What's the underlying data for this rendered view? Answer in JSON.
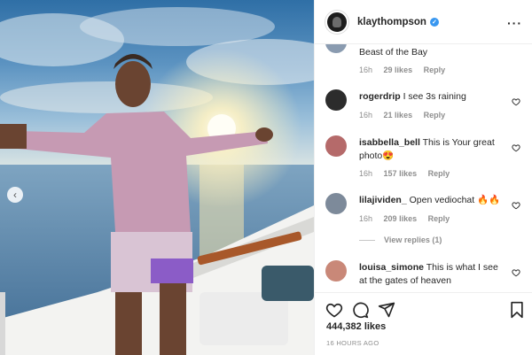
{
  "post": {
    "username": "klaythompson",
    "likes": "444,382 likes",
    "time_ago": "16 HOURS AGO"
  },
  "comments": [
    {
      "user": "",
      "text": "Beast of the Bay",
      "age": "16h",
      "likes": "29 likes",
      "reply": "Reply",
      "avatar_color": "#8a9bb0"
    },
    {
      "user": "rogerdrip",
      "text": "I see 3s raining",
      "age": "16h",
      "likes": "21 likes",
      "reply": "Reply",
      "avatar_color": "#2c2c2c"
    },
    {
      "user": "isabbella_bell",
      "text": "This is Your great photo😍",
      "age": "16h",
      "likes": "157 likes",
      "reply": "Reply",
      "avatar_color": "#b56a6a"
    },
    {
      "user": "lilajividen_",
      "text": "Open vediochat 🔥🔥",
      "age": "16h",
      "likes": "209 likes",
      "reply": "Reply",
      "avatar_color": "#7d8a9a"
    },
    {
      "user": "louisa_simone",
      "text": "This is what I see at the gates of heaven",
      "age": "",
      "likes": "",
      "reply": "",
      "avatar_color": "#c98878"
    }
  ],
  "view_replies": "View replies (1)",
  "icons": {
    "more": "more-options-icon",
    "verified": "verified-badge-icon",
    "like": "heart-icon",
    "comment": "comment-icon",
    "share": "share-icon",
    "save": "bookmark-icon",
    "prev": "chevron-left-icon"
  }
}
